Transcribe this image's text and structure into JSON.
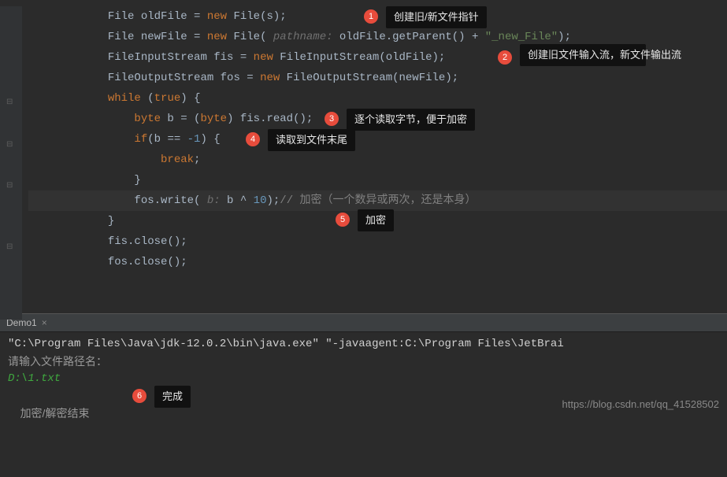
{
  "code": {
    "line1": {
      "text_a": "File oldFile = ",
      "kw": "new",
      "text_b": " File(s);"
    },
    "line2": {
      "text_a": "File newFile = ",
      "kw": "new",
      "text_b": " File( ",
      "param": "pathname:",
      "text_c": " oldFile.getParent() + ",
      "str": "\"_new_File\"",
      "text_d": ");"
    },
    "line3": {
      "text_a": "FileInputStream fis = ",
      "kw": "new",
      "text_b": " FileInputStream(oldFile);"
    },
    "line4": {
      "text_a": "FileOutputStream fos = ",
      "kw": "new",
      "text_b": " FileOutputStream(newFile);"
    },
    "line5": {
      "kw_while": "while",
      "text_a": " (",
      "kw_true": "true",
      "text_b": ") {"
    },
    "line6": {
      "kw_byte": "byte",
      "text_a": " b = (",
      "kw_cast": "byte",
      "text_b": ") fis.read();"
    },
    "line7": {
      "kw_if": "if",
      "text_a": "(b == ",
      "num": "-1",
      "text_b": ") {"
    },
    "line8": {
      "kw": "break",
      "text": ";"
    },
    "line9": {
      "text": "}"
    },
    "line10": {
      "text_a": "fos.write( ",
      "param": "b:",
      "text_b": " b ^ ",
      "num": "10",
      "text_c": ");",
      "comment": "// 加密（一个数异或两次，还是本身）"
    },
    "line11": {
      "text": "}"
    },
    "line12": {
      "text": "fis.close();"
    },
    "line13": {
      "text": "fos.close();"
    }
  },
  "annotations": {
    "a1": {
      "num": "1",
      "label": "创建旧/新文件指针"
    },
    "a2": {
      "num": "2",
      "label": "创建旧文件输入流，新文件输出流"
    },
    "a3": {
      "num": "3",
      "label": "逐个读取字节，便于加密"
    },
    "a4": {
      "num": "4",
      "label": "读取到文件末尾"
    },
    "a5": {
      "num": "5",
      "label": "加密"
    },
    "a6": {
      "num": "6",
      "label": "完成"
    }
  },
  "tab": {
    "name": "Demo1",
    "close": "×"
  },
  "console": {
    "cmd": "\"C:\\Program Files\\Java\\jdk-12.0.2\\bin\\java.exe\" \"-javaagent:C:\\Program Files\\JetBrai",
    "prompt": "请输入文件路径名：",
    "input": "D:\\1.txt",
    "result": "加密/解密结束"
  },
  "watermark": "https://blog.csdn.net/qq_41528502"
}
